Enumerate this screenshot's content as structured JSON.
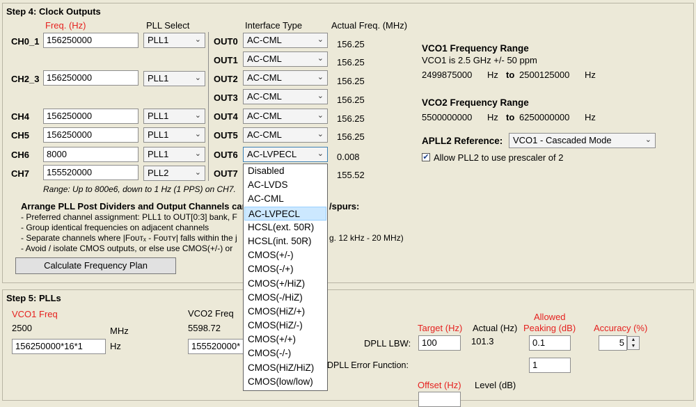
{
  "step4": {
    "title": "Step 4: Clock Outputs",
    "headers": {
      "freq": "Freq. (Hz)",
      "pll_select": "PLL Select",
      "interface_type": "Interface Type",
      "actual_freq": "Actual Freq. (MHz)"
    },
    "channels": [
      {
        "label": "CH0_1",
        "freq": "156250000",
        "pll": "PLL1"
      },
      {
        "label": "CH2_3",
        "freq": "156250000",
        "pll": "PLL1"
      },
      {
        "label": "CH4",
        "freq": "156250000",
        "pll": "PLL1"
      },
      {
        "label": "CH5",
        "freq": "156250000",
        "pll": "PLL1"
      },
      {
        "label": "CH6",
        "freq": "8000",
        "pll": "PLL1"
      },
      {
        "label": "CH7",
        "freq": "155520000",
        "pll": "PLL2"
      }
    ],
    "outputs": [
      {
        "label": "OUT0",
        "iface": "AC-CML",
        "actual": "156.25"
      },
      {
        "label": "OUT1",
        "iface": "AC-CML",
        "actual": "156.25"
      },
      {
        "label": "OUT2",
        "iface": "AC-CML",
        "actual": "156.25"
      },
      {
        "label": "OUT3",
        "iface": "AC-CML",
        "actual": "156.25"
      },
      {
        "label": "OUT4",
        "iface": "AC-CML",
        "actual": "156.25"
      },
      {
        "label": "OUT5",
        "iface": "AC-CML",
        "actual": "156.25"
      },
      {
        "label": "OUT6",
        "iface": "AC-LVPECL",
        "actual": "0.008"
      },
      {
        "label": "OUT7",
        "iface": "",
        "actual": "155.52"
      }
    ],
    "range_note": "Range: Up to 800e6, down to 1 Hz (1 PPS) on CH7.",
    "arrange_title_a": "Arrange PLL Post Dividers and Output Channels caref",
    "arrange_title_b": "/spurs:",
    "bullets": [
      "- Preferred channel assignment: PLL1 to OUT[0:3] bank, F",
      "- Group identical frequencies on adjacent channels",
      "- Separate channels where |Fᴏᴜᴛₓ - Fᴏᴜᴛʏ| falls within the j",
      "- Avoid / isolate CMOS outputs, or else use CMOS(+/-) or"
    ],
    "bullet3_tail": "g. 12 kHz - 20 MHz)",
    "calc_button": "Calculate Frequency Plan",
    "vco1_range": {
      "title": "VCO1 Frequency Range",
      "note": "VCO1 is 2.5 GHz +/- 50 ppm",
      "min": "2499875000",
      "max": "2500125000",
      "unit": "Hz",
      "to": "to"
    },
    "vco2_range": {
      "title": "VCO2 Frequency Range",
      "min": "5500000000",
      "max": "6250000000",
      "unit": "Hz",
      "to": "to"
    },
    "apll2_ref": {
      "label": "APLL2 Reference:",
      "value": "VCO1 - Cascaded Mode"
    },
    "prescaler": {
      "label": "Allow PLL2 to use prescaler of 2",
      "checked": true
    }
  },
  "dropdown": {
    "options": [
      "Disabled",
      "AC-LVDS",
      "AC-CML",
      "AC-LVPECL",
      "HCSL(ext. 50R)",
      "HCSL(int. 50R)",
      "CMOS(+/-)",
      "CMOS(-/+)",
      "CMOS(+/HiZ)",
      "CMOS(-/HiZ)",
      "CMOS(HiZ/+)",
      "CMOS(HiZ/-)",
      "CMOS(+/+)",
      "CMOS(-/-)",
      "CMOS(HiZ/HiZ)",
      "CMOS(low/low)"
    ],
    "selected": "AC-LVPECL"
  },
  "step5": {
    "title": "Step 5: PLLs",
    "vco1": {
      "label": "VCO1 Freq",
      "value": "2500",
      "unit": "MHz",
      "expr": "156250000*16*1",
      "expr_unit": "Hz"
    },
    "vco2": {
      "label": "VCO2 Freq",
      "value": "5598.72",
      "expr": "155520000*"
    },
    "headers": {
      "target": "Target (Hz)",
      "actual": "Actual (Hz)",
      "allowed": "Allowed",
      "peaking": "Peaking (dB)",
      "accuracy": "Accuracy (%)"
    },
    "dpll_lbw": {
      "label": "DPLL LBW:",
      "target": "100",
      "actual": "101.3",
      "peaking": "0.1",
      "accuracy": "5"
    },
    "dpll_err": {
      "label": "DPLL Error Function:",
      "value": "1"
    },
    "offset_label": "Offset (Hz)",
    "level_label": "Level (dB)"
  },
  "colors": {
    "background": "#ece9d8",
    "label_red": "#e5211f",
    "highlight": "#cce8ff"
  }
}
